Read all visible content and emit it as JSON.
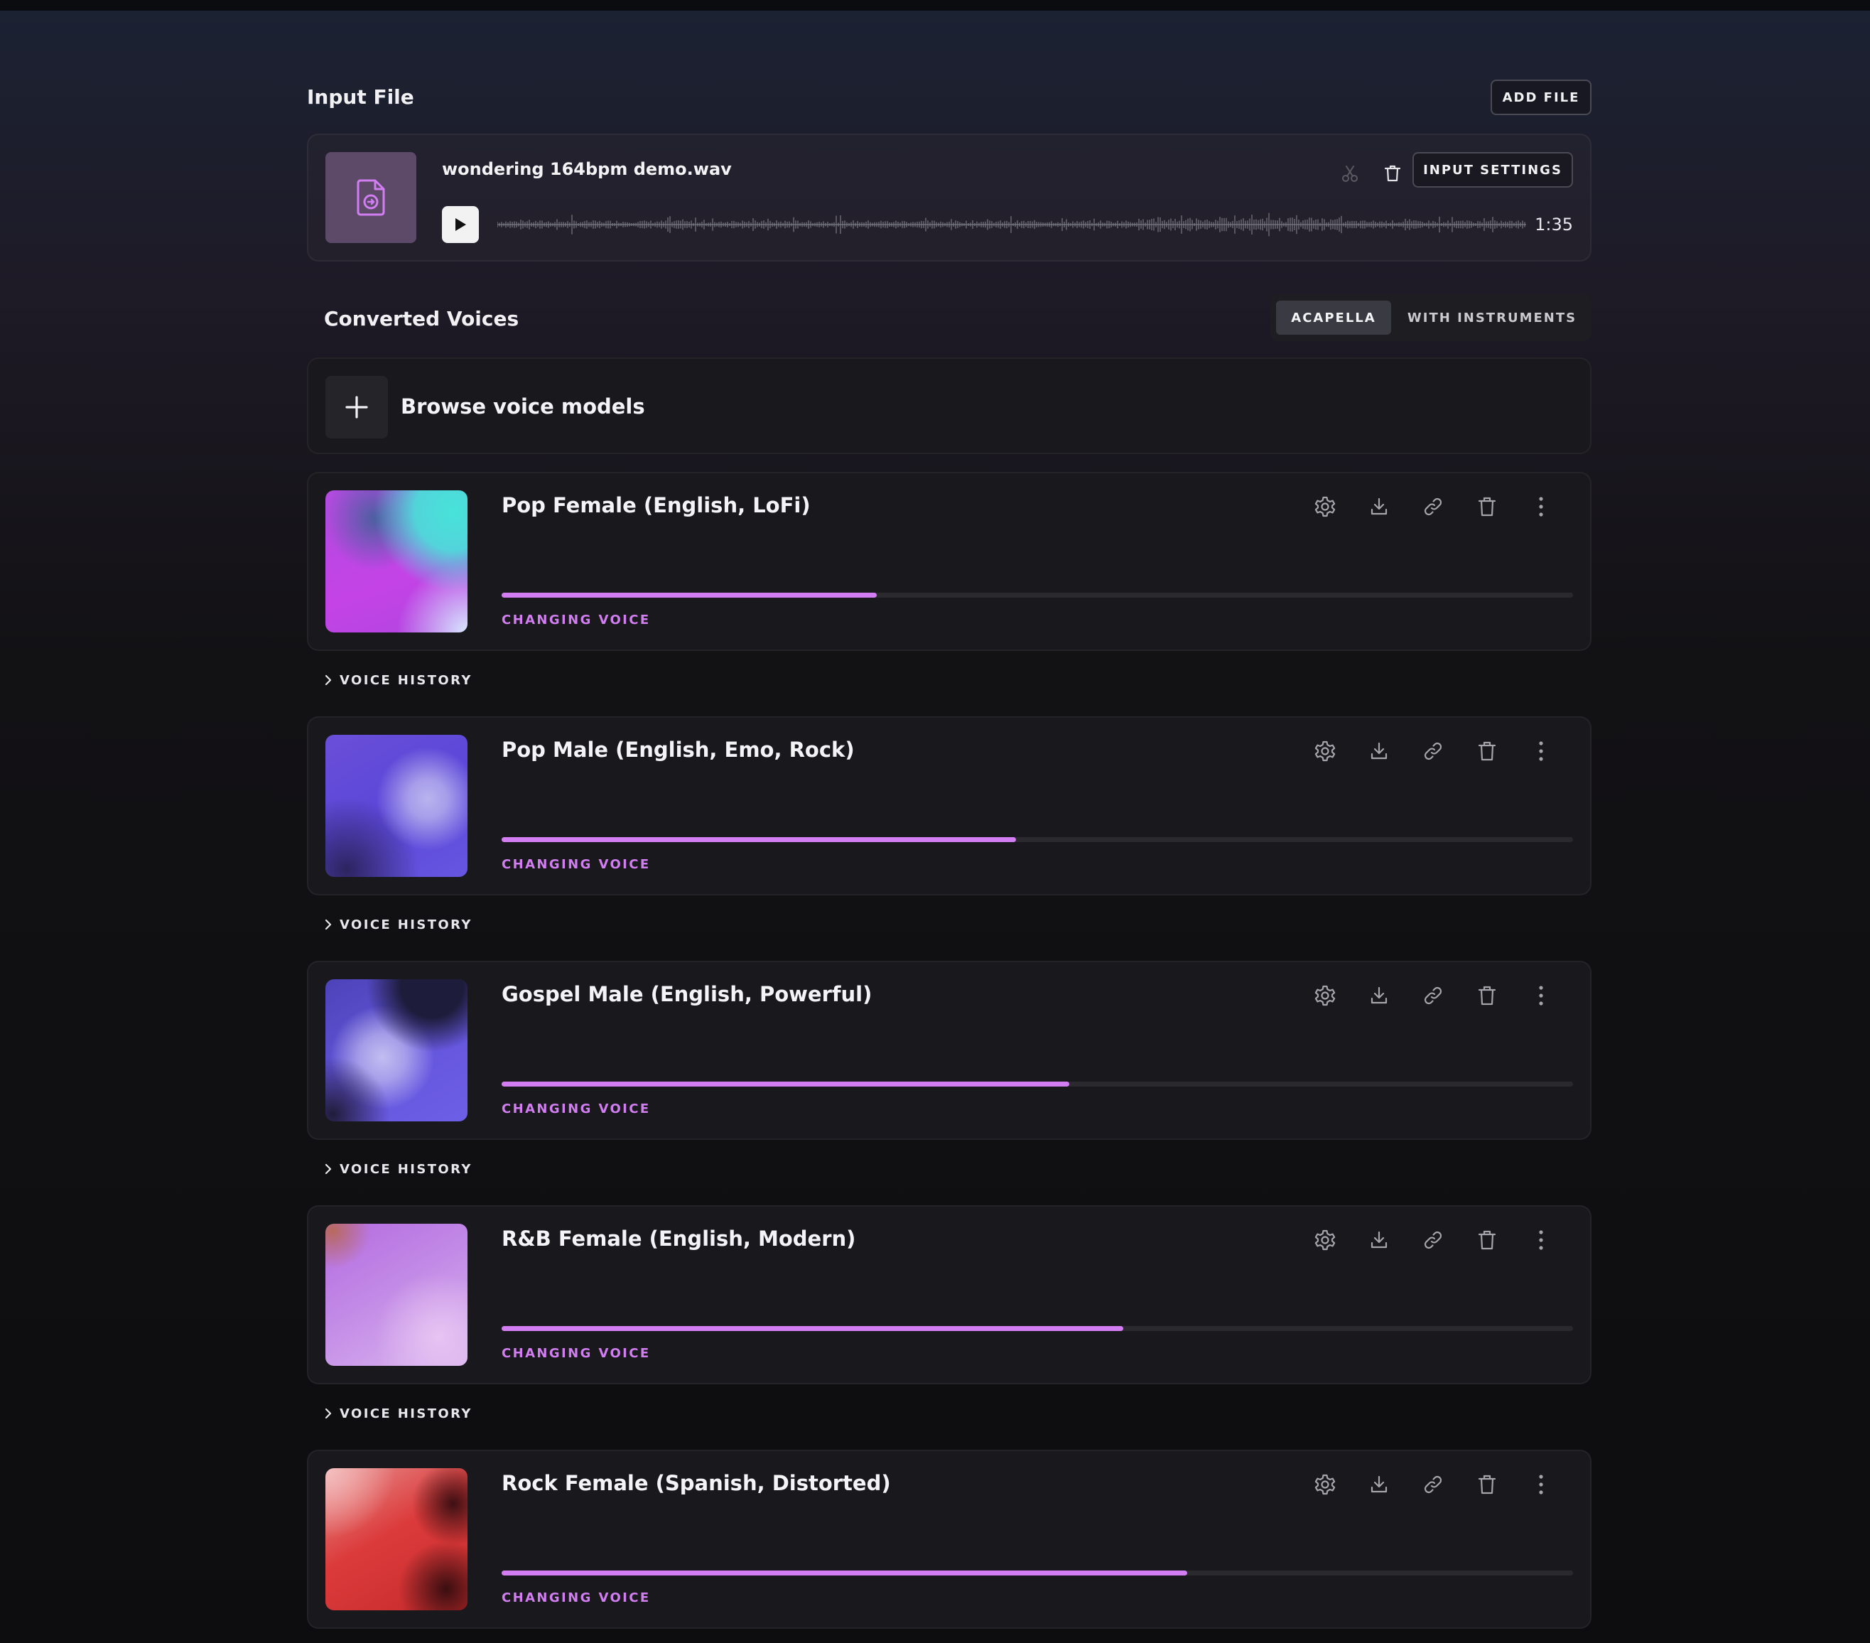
{
  "input_section": {
    "title": "Input File",
    "add_file_label": "ADD FILE",
    "file": {
      "name": "wondering 164bpm demo.wav",
      "duration": "1:35",
      "settings_label": "INPUT SETTINGS"
    }
  },
  "converted_section": {
    "title": "Converted Voices",
    "mode_options": [
      {
        "label": "ACAPELLA",
        "selected": true
      },
      {
        "label": "WITH INSTRUMENTS",
        "selected": false
      }
    ],
    "browse_label": "Browse voice models"
  },
  "voices": [
    {
      "name": "Pop Female (English, LoFi)",
      "progress": 0.35,
      "status": "CHANGING VOICE",
      "history_label": "VOICE HISTORY"
    },
    {
      "name": "Pop Male (English, Emo, Rock)",
      "progress": 0.48,
      "status": "CHANGING VOICE",
      "history_label": "VOICE HISTORY"
    },
    {
      "name": "Gospel Male (English, Powerful)",
      "progress": 0.53,
      "status": "CHANGING VOICE",
      "history_label": "VOICE HISTORY"
    },
    {
      "name": "R&B Female (English, Modern)",
      "progress": 0.58,
      "status": "CHANGING VOICE",
      "history_label": "VOICE HISTORY"
    },
    {
      "name": "Rock Female (Spanish, Distorted)",
      "progress": 0.64,
      "status": "CHANGING VOICE"
    }
  ],
  "icons": {
    "file": "file-import-icon",
    "play": "play-icon",
    "cut": "scissors-icon",
    "delete": "trash-icon",
    "plus": "plus-icon",
    "settings": "gear-icon",
    "download": "download-icon",
    "link": "link-icon",
    "more": "more-vertical-icon",
    "chevron": "chevron-right-icon"
  },
  "colors": {
    "accent": "#d27ef2",
    "file_thumb": "#5c4a68",
    "card": "#19181c"
  }
}
